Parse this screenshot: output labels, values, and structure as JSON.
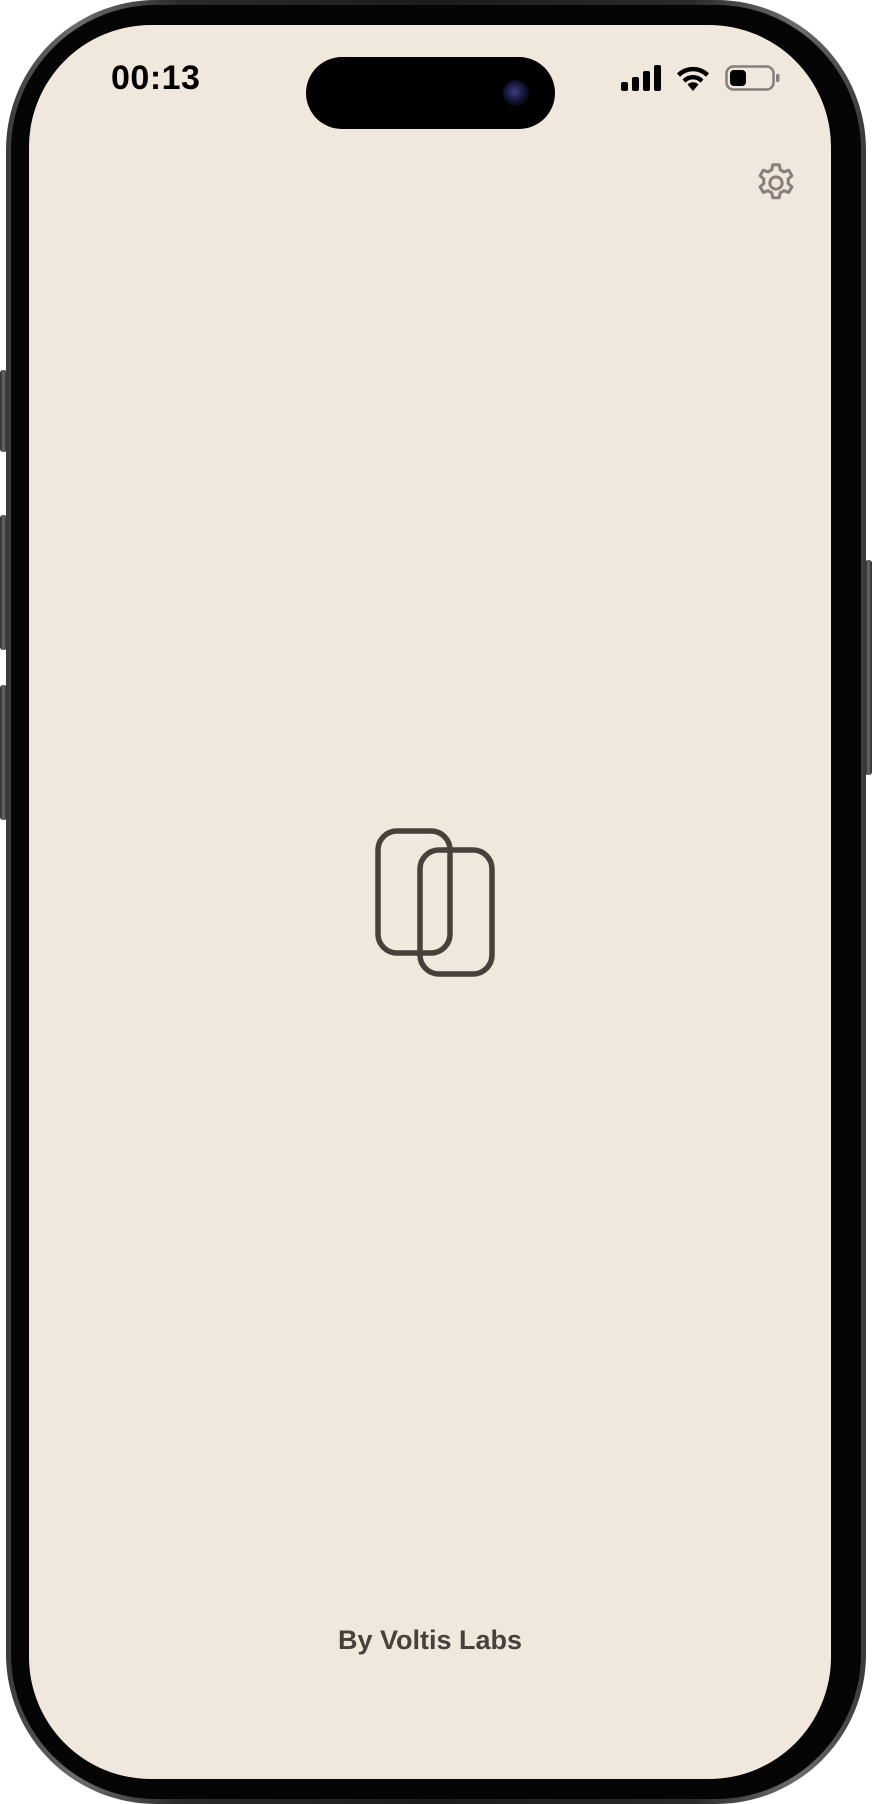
{
  "status_bar": {
    "time": "00:13",
    "signal_icon": "cellular-signal-icon",
    "wifi_icon": "wifi-icon",
    "battery_icon": "battery-icon",
    "battery_level": 0.35
  },
  "header": {
    "settings_icon": "gear-icon"
  },
  "main": {
    "logo_icon": "overlapping-cards-logo"
  },
  "footer": {
    "credit": "By Voltis Labs"
  },
  "colors": {
    "background": "#f1e8dd",
    "logo": "#4a403b",
    "gear": "#8a7f79",
    "footer_text": "#4a403b"
  }
}
